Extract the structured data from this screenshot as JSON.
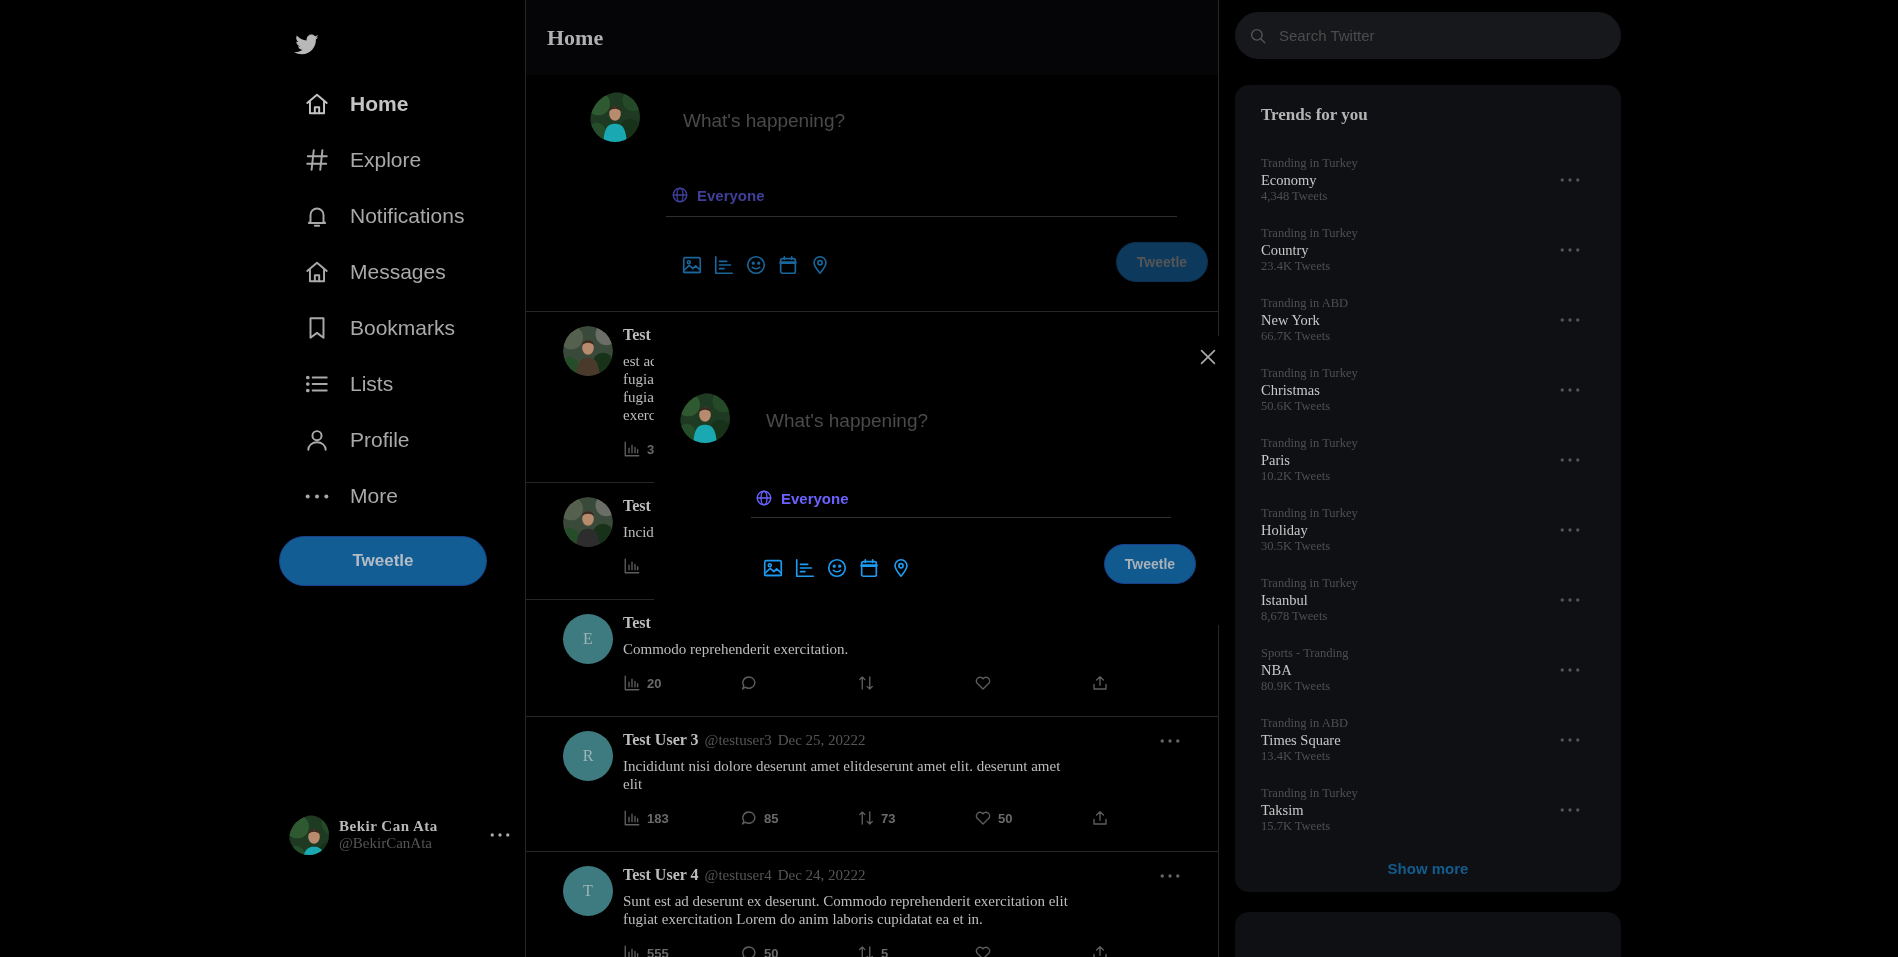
{
  "sidebar": {
    "nav": [
      {
        "label": "Home",
        "selected": true
      },
      {
        "label": "Explore",
        "selected": false
      },
      {
        "label": "Notifications",
        "selected": false
      },
      {
        "label": "Messages",
        "selected": false
      },
      {
        "label": "Bookmarks",
        "selected": false
      },
      {
        "label": "Lists",
        "selected": false
      },
      {
        "label": "Profile",
        "selected": false
      },
      {
        "label": "More",
        "selected": false
      }
    ],
    "tweet_button": "Tweetle",
    "account": {
      "name": "Bekir Can Ata",
      "handle": "@BekirCanAta"
    }
  },
  "main": {
    "title": "Home",
    "composer": {
      "placeholder": "What's happening?",
      "audience": "Everyone",
      "button": "Tweetle"
    },
    "tweets": [
      {
        "name": "Test",
        "avatar": {
          "kind": "picture"
        },
        "menu": false,
        "body_lines": [
          "est ac",
          "fugia",
          "fugia",
          "exerc"
        ],
        "stats": [
          {
            "kind": "views",
            "count": "3"
          }
        ]
      },
      {
        "name": "Test",
        "avatar": {
          "kind": "picture"
        },
        "menu": false,
        "body_lines": [
          "Incid"
        ],
        "stats": [
          {
            "kind": "views"
          }
        ]
      },
      {
        "name": "Test",
        "avatar": {
          "kind": "letter",
          "letter": "E"
        },
        "menu": false,
        "body": "Commodo reprehenderit exercitation.",
        "stats": [
          {
            "kind": "views",
            "count": "20"
          },
          {
            "kind": "replies"
          },
          {
            "kind": "retweets"
          },
          {
            "kind": "likes"
          },
          {
            "kind": "share"
          }
        ]
      },
      {
        "name": "Test User 3",
        "handle": "@testuser3",
        "date": "Dec 25, 20222",
        "avatar": {
          "kind": "letter",
          "letter": "R"
        },
        "menu": true,
        "body": "Incididunt nisi dolore deserunt amet elitdeserunt amet elit. deserunt amet elit",
        "stats": [
          {
            "kind": "views",
            "count": "183"
          },
          {
            "kind": "replies",
            "count": "85"
          },
          {
            "kind": "retweets",
            "count": "73"
          },
          {
            "kind": "likes",
            "count": "50"
          },
          {
            "kind": "share"
          }
        ]
      },
      {
        "name": "Test User 4",
        "handle": "@testuser4",
        "date": "Dec 24, 20222",
        "avatar": {
          "kind": "letter",
          "letter": "T"
        },
        "menu": true,
        "body": "Sunt est ad deserunt ex deserunt. Commodo reprehenderit exercitation elit fugiat exercitation Lorem do anim laboris cupidatat ea et in.",
        "stats": [
          {
            "kind": "views",
            "count": "555"
          },
          {
            "kind": "replies",
            "count": "50"
          },
          {
            "kind": "retweets",
            "count": "5"
          },
          {
            "kind": "likes"
          },
          {
            "kind": "share"
          }
        ]
      }
    ],
    "modal": {
      "placeholder": "What's happening?",
      "audience": "Everyone",
      "button": "Tweetle"
    }
  },
  "right": {
    "search": {
      "placeholder": "Search Twitter"
    },
    "trends": {
      "title": "Trends for you",
      "items": [
        {
          "category": "Tranding in Turkey",
          "name": "Economy",
          "count": "4,348 Tweets"
        },
        {
          "category": "Tranding in Turkey",
          "name": "Country",
          "count": "23.4K Tweets"
        },
        {
          "category": "Tranding in ABD",
          "name": "New York",
          "count": "66.7K Tweets"
        },
        {
          "category": "Tranding in Turkey",
          "name": "Christmas",
          "count": "50.6K Tweets"
        },
        {
          "category": "Tranding in Turkey",
          "name": "Paris",
          "count": "10.2K Tweets"
        },
        {
          "category": "Tranding in Turkey",
          "name": "Holiday",
          "count": "30.5K Tweets"
        },
        {
          "category": "Tranding in Turkey",
          "name": "Istanbul",
          "count": "8,678 Tweets"
        },
        {
          "category": "Sports - Tranding",
          "name": "NBA",
          "count": "80.9K Tweets"
        },
        {
          "category": "Tranding in ABD",
          "name": "Times Square",
          "count": "13.4K Tweets"
        },
        {
          "category": "Tranding in Turkey",
          "name": "Taksim",
          "count": "15.7K Tweets"
        }
      ],
      "show_more": "Show more"
    }
  }
}
